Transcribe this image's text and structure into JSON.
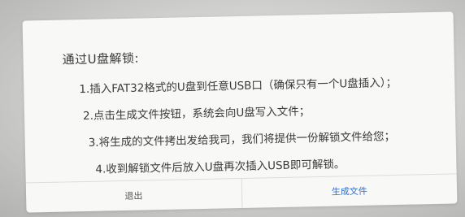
{
  "dialog": {
    "title": "通过U盘解锁:",
    "steps": [
      "1.插入FAT32格式的U盘到任意USB口（确保只有一个U盘插入）；",
      "2.点击生成文件按钮，系统会向U盘写入文件；",
      "3.将生成的文件拷出发给我司，我们将提供一份解锁文件给您；",
      "4.收到解锁文件后放入U盘再次插入USB即可解锁。"
    ],
    "buttons": {
      "exit_label": "退出",
      "generate_label": "生成文件"
    }
  },
  "colors": {
    "accent": "#2f6fd1",
    "text": "#3a3a3a",
    "dialog_bg": "#f8f8f6"
  }
}
